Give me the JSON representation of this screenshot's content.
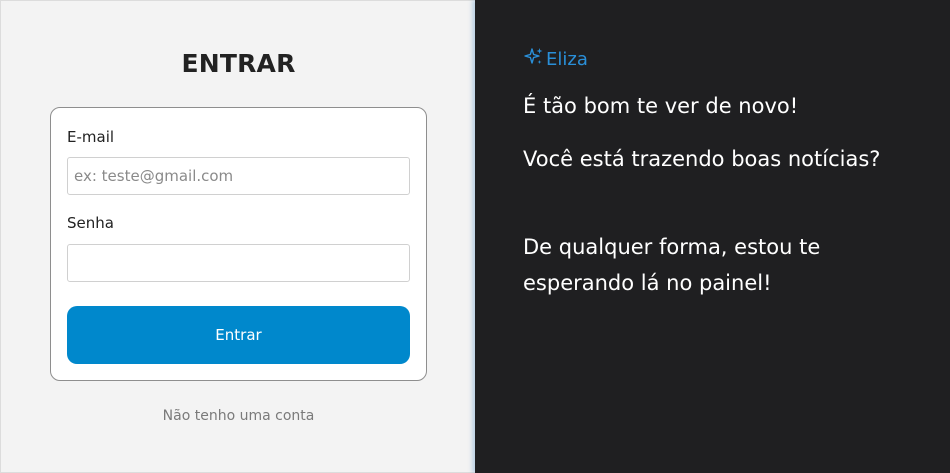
{
  "login": {
    "title": "ENTRAR",
    "email_label": "E-mail",
    "email_placeholder": "ex: teste@gmail.com",
    "email_value": "",
    "password_label": "Senha",
    "password_value": "",
    "submit_label": "Entrar",
    "no_account_link": "Não tenho uma conta"
  },
  "welcome": {
    "brand_icon": "sparkles-icon",
    "brand_name": "Eliza",
    "messages": [
      "É tão bom te ver de novo!",
      "Você está trazendo boas notícias?",
      "De qualquer forma, estou te esperando lá no painel!"
    ]
  },
  "colors": {
    "accent": "#0088cc",
    "brand": "#2a8fd8",
    "dark_panel": "#1f1f21",
    "light_panel": "#f3f3f3"
  }
}
